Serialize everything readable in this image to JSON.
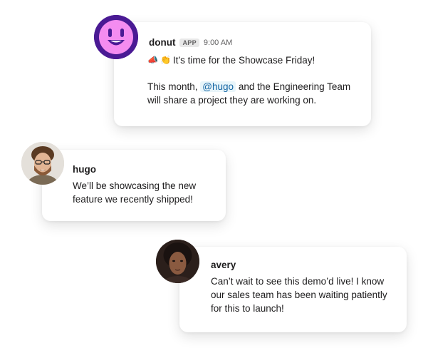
{
  "messages": [
    {
      "author": "donut",
      "badge": "APP",
      "time": "9:00 AM",
      "line1_emoji": [
        "📣",
        "👏"
      ],
      "line1": "It’s time for the Showcase Friday!",
      "line2_pre": "This month,",
      "mention": "@hugo",
      "line2_post": "and the Engineering Team will share a project they are working on."
    },
    {
      "author": "hugo",
      "text": "We’ll be showcasing the new feature we recently shipped!"
    },
    {
      "author": "avery",
      "text": "Can’t wait to see this demo’d live! I know our sales team has been waiting patiently for this to launch!"
    }
  ],
  "colors": {
    "donut_avatar_bg": "#4a1a94",
    "donut_face": "#f48cf0",
    "mention_bg": "#e8f5fa",
    "mention_text": "#1264a3"
  },
  "icons": {
    "donut_avatar": "smiling-face-icon",
    "emoji_1": "megaphone-icon",
    "emoji_2": "clapping-hands-icon"
  }
}
